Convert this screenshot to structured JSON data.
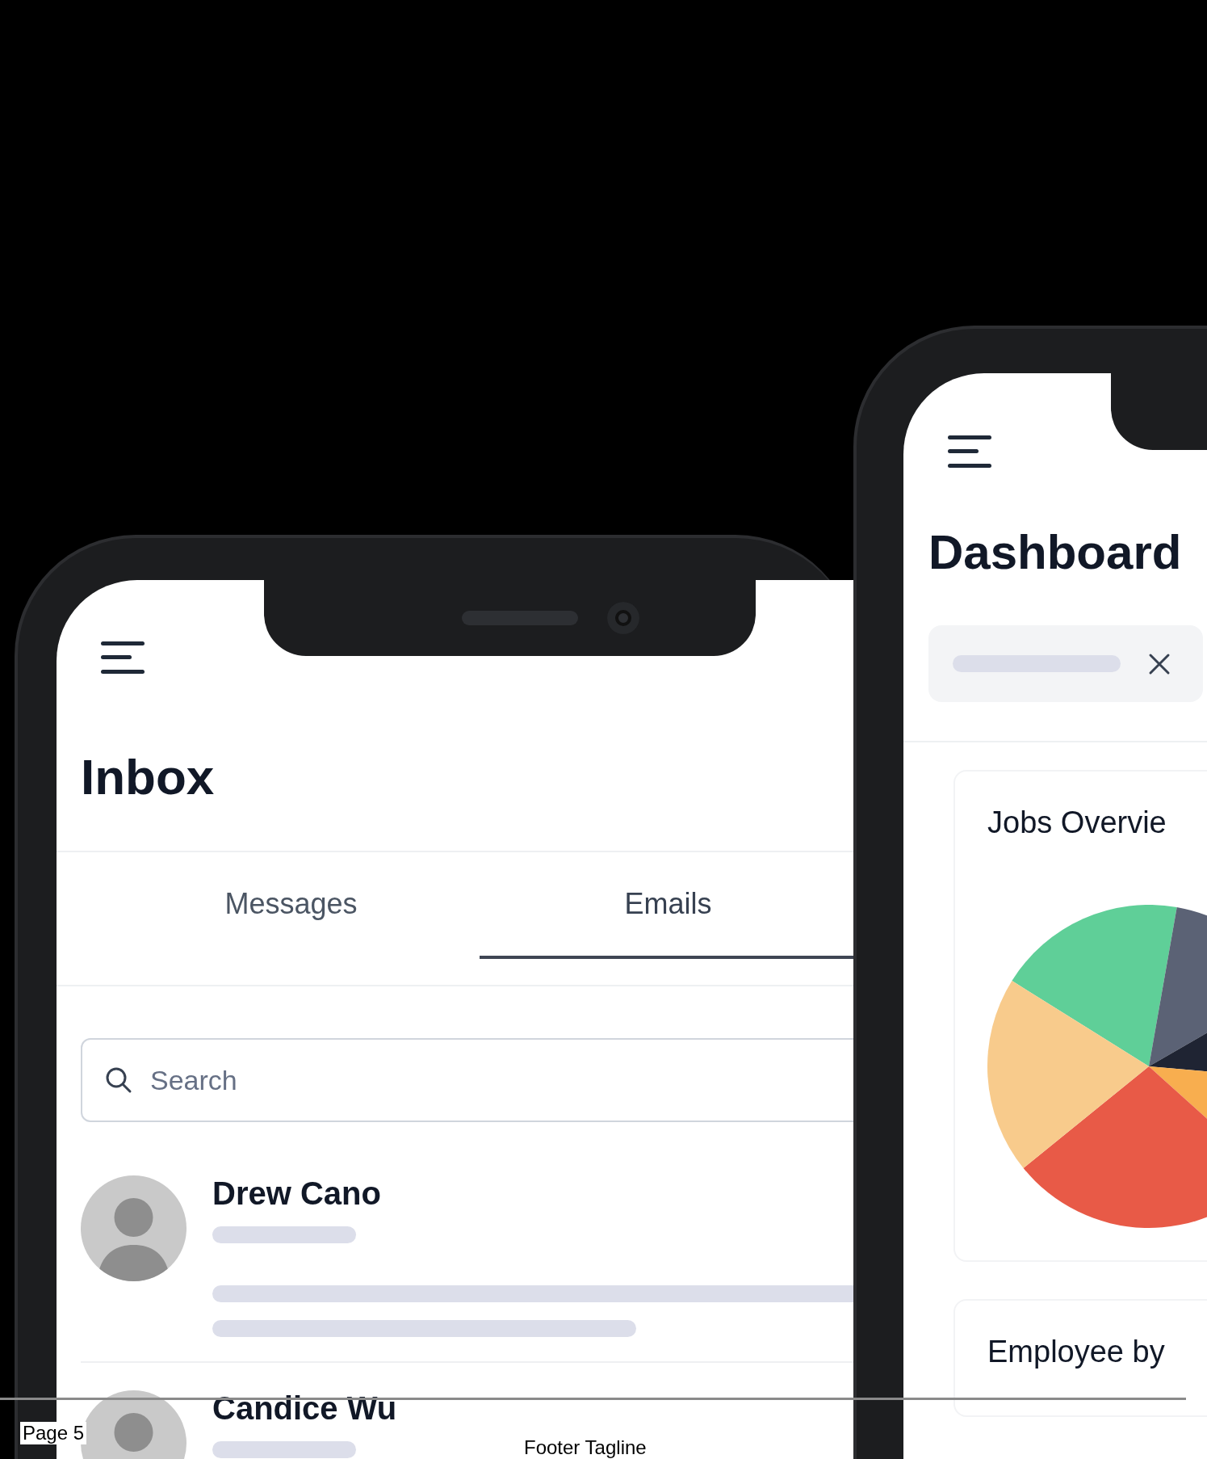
{
  "inbox_screen": {
    "title": "Inbox",
    "tabs": [
      {
        "label": "Messages",
        "selected": false
      },
      {
        "label": "Emails",
        "selected": true
      }
    ],
    "search": {
      "placeholder": "Search"
    },
    "contacts": [
      {
        "name": "Drew Cano"
      },
      {
        "name": "Candice Wu"
      }
    ]
  },
  "dashboard_screen": {
    "title": "Dashboard",
    "cards": [
      {
        "title": "Jobs Overvie",
        "kind": "pie"
      },
      {
        "title": "Employee by",
        "kind": "text"
      }
    ]
  },
  "footer": {
    "page": "Page 5",
    "tagline": "Footer Tagline"
  }
}
